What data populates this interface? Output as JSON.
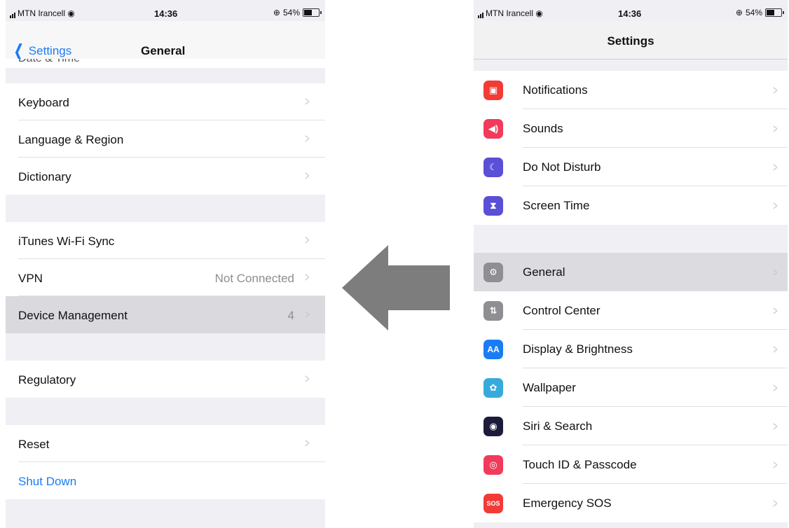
{
  "left": {
    "status": {
      "carrier": "MTN Irancell",
      "time": "14:36",
      "battery": "54%"
    },
    "nav": {
      "back_label": "Settings",
      "title": "General"
    },
    "cut_item": "Date & Time",
    "groups": [
      [
        {
          "label": "Keyboard"
        },
        {
          "label": "Language & Region"
        },
        {
          "label": "Dictionary"
        }
      ],
      [
        {
          "label": "iTunes Wi-Fi Sync"
        },
        {
          "label": "VPN",
          "value": "Not Connected"
        },
        {
          "label": "Device Management",
          "value": "4",
          "highlighted": true
        }
      ],
      [
        {
          "label": "Regulatory"
        }
      ],
      [
        {
          "label": "Reset"
        },
        {
          "label": "Shut Down",
          "style": "link"
        }
      ]
    ]
  },
  "right": {
    "status": {
      "carrier": "MTN Irancell",
      "time": "14:36",
      "battery": "54%"
    },
    "nav": {
      "title": "Settings"
    },
    "groups": [
      [
        {
          "label": "Notifications",
          "icon": "notifications-icon",
          "color": "#f23b36"
        },
        {
          "label": "Sounds",
          "icon": "sounds-icon",
          "color": "#f23a5a"
        },
        {
          "label": "Do Not Disturb",
          "icon": "moon-icon",
          "color": "#5a4fd6"
        },
        {
          "label": "Screen Time",
          "icon": "hourglass-icon",
          "color": "#5a4fd6"
        }
      ],
      [
        {
          "label": "General",
          "icon": "gear-icon",
          "color": "#8e8e93",
          "highlighted": true
        },
        {
          "label": "Control Center",
          "icon": "switches-icon",
          "color": "#8e8e93"
        },
        {
          "label": "Display & Brightness",
          "icon": "aa-icon",
          "color": "#1a7cf5",
          "glyph": "AA"
        },
        {
          "label": "Wallpaper",
          "icon": "flower-icon",
          "color": "#37aadc"
        },
        {
          "label": "Siri & Search",
          "icon": "siri-icon",
          "color": "#1c1c3a"
        },
        {
          "label": "Touch ID & Passcode",
          "icon": "fingerprint-icon",
          "color": "#f23a5a"
        },
        {
          "label": "Emergency SOS",
          "icon": "sos-icon",
          "color": "#f23b36",
          "glyph": "SOS"
        }
      ]
    ]
  }
}
